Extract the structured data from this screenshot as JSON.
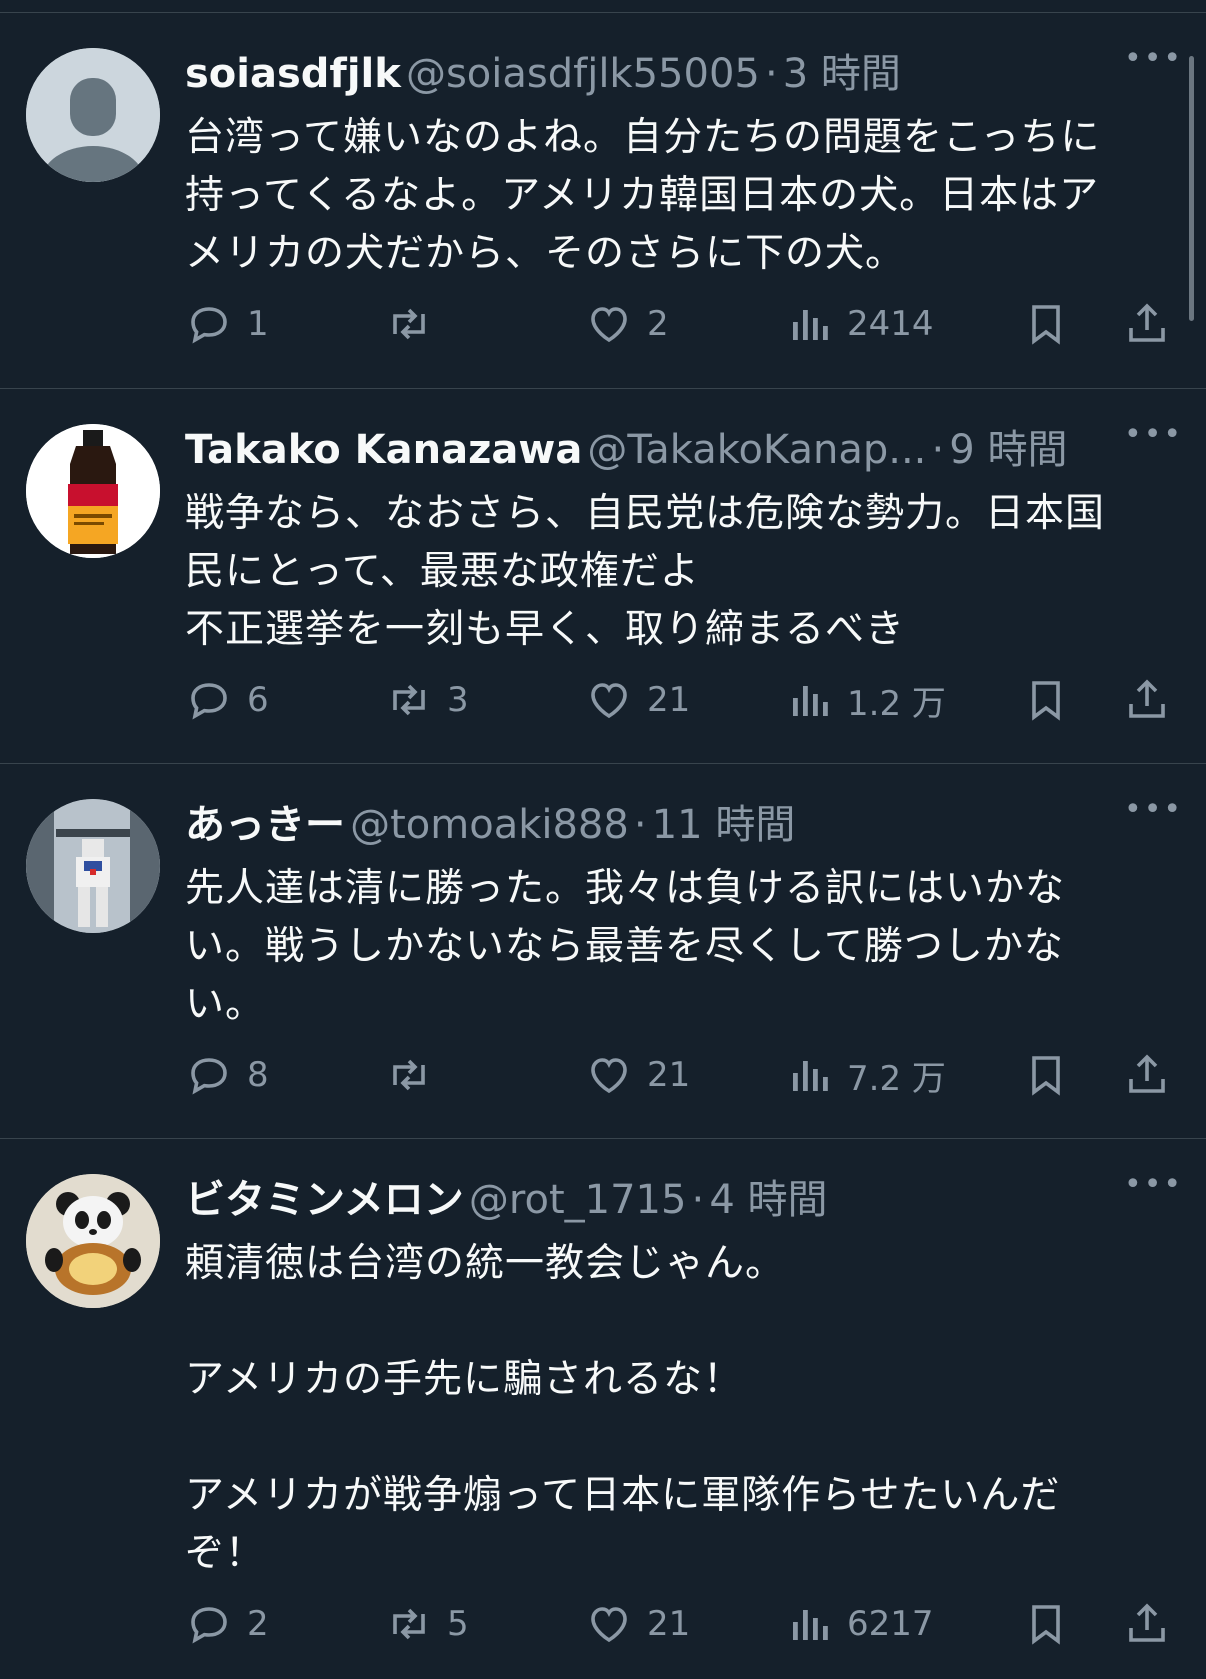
{
  "tweets": [
    {
      "name": "soiasdfjlk",
      "handle": "@soiasdfjlk55005",
      "time": "3 時間",
      "text": "台湾って嫌いなのよね。自分たちの問題をこっちに\n持ってくるなよ。アメリカ韓国日本の犬。日本はア\nメリカの犬だから、そのさらに下の犬。",
      "replies": "1",
      "retweets": "",
      "likes": "2",
      "views": "2414"
    },
    {
      "name": "Takako Kanazawa",
      "handle": "@TakakoKanap...",
      "time": "9 時間",
      "text": "戦争なら、なおさら、自民党は危険な勢力。日本国\n民にとって、最悪な政権だよ\n不正選挙を一刻も早く、取り締まるべき",
      "replies": "6",
      "retweets": "3",
      "likes": "21",
      "views": "1.2 万"
    },
    {
      "name": "あっきー",
      "handle": "@tomoaki888",
      "time": "11 時間",
      "text": "先人達は清に勝った。我々は負ける訳にはいかな\nい。戦うしかないなら最善を尽くして勝つしかな\nい。",
      "replies": "8",
      "retweets": "",
      "likes": "21",
      "views": "7.2 万"
    },
    {
      "name": "ビタミンメロン",
      "handle": "@rot_1715",
      "time": "4 時間",
      "text": "頼清徳は台湾の統一教会じゃん。\n\nアメリカの手先に騙されるな！\n\nアメリカが戦争煽って日本に軍隊作らせたいんだ\nぞ！",
      "replies": "2",
      "retweets": "5",
      "likes": "21",
      "views": "6217"
    }
  ],
  "colors": {
    "background": "#15202b",
    "text": "#f7f9f9",
    "muted": "#8b98a5",
    "divider": "#38444d"
  },
  "icons": [
    "reply-icon",
    "retweet-icon",
    "like-icon",
    "views-icon",
    "bookmark-icon",
    "share-icon",
    "more-icon"
  ]
}
